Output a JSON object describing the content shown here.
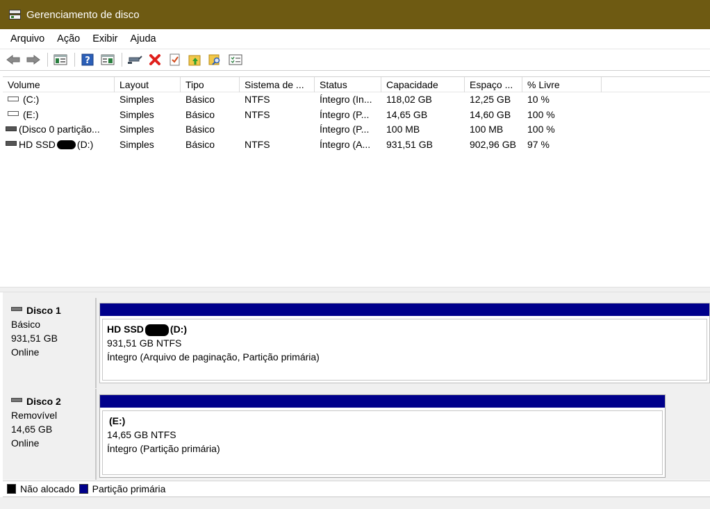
{
  "window": {
    "title": "Gerenciamento de disco"
  },
  "menu": {
    "items": [
      "Arquivo",
      "Ação",
      "Exibir",
      "Ajuda"
    ]
  },
  "toolbar": {
    "icons": [
      "back-arrow-icon",
      "forward-arrow-icon",
      "console-tree-icon",
      "help-icon",
      "properties-icon",
      "connect-icon",
      "delete-icon",
      "check-icon",
      "folder-up-icon",
      "folder-search-icon",
      "list-icon"
    ],
    "delete_color": "#e0201c"
  },
  "volumes": {
    "columns": [
      "Volume",
      "Layout",
      "Tipo",
      "Sistema de ...",
      "Status",
      "Capacidade",
      "Espaço ...",
      "% Livre"
    ],
    "rows": [
      {
        "volume": "(C:)",
        "layout": "Simples",
        "tipo": "Básico",
        "sistema": "NTFS",
        "status": "Íntegro (In...",
        "capacidade": "118,02 GB",
        "espaco": "12,25 GB",
        "livre": "10 %"
      },
      {
        "volume": "(E:)",
        "layout": "Simples",
        "tipo": "Básico",
        "sistema": "NTFS",
        "status": "Íntegro (P...",
        "capacidade": "14,65 GB",
        "espaco": "14,60 GB",
        "livre": "100 %"
      },
      {
        "volume": "(Disco 0 partição...",
        "layout": "Simples",
        "tipo": "Básico",
        "sistema": "",
        "status": "Íntegro (P...",
        "capacidade": "100 MB",
        "espaco": "100 MB",
        "livre": "100 %"
      },
      {
        "volume_prefix": "HD SSD",
        "volume_suffix": "(D:)",
        "layout": "Simples",
        "tipo": "Básico",
        "sistema": "NTFS",
        "status": "Íntegro (A...",
        "capacidade": "931,51 GB",
        "espaco": "902,96 GB",
        "livre": "97 %"
      }
    ]
  },
  "disks": [
    {
      "name": "Disco 1",
      "type": "Básico",
      "size": "931,51 GB",
      "state": "Online",
      "partition": {
        "name_prefix": "HD SSD",
        "name_suffix": "(D:)",
        "size_fs": "931,51 GB NTFS",
        "status": "Íntegro (Arquivo de paginação, Partição primária)"
      }
    },
    {
      "name": "Disco 2",
      "type": "Removível",
      "size": "14,65 GB",
      "state": "Online",
      "partition": {
        "name": "(E:)",
        "size_fs": "14,65 GB NTFS",
        "status": "Íntegro (Partição primária)"
      }
    }
  ],
  "legend": {
    "items": [
      {
        "label": "Não alocado",
        "color": "#000000"
      },
      {
        "label": "Partição primária",
        "color": "#00008b"
      }
    ]
  }
}
